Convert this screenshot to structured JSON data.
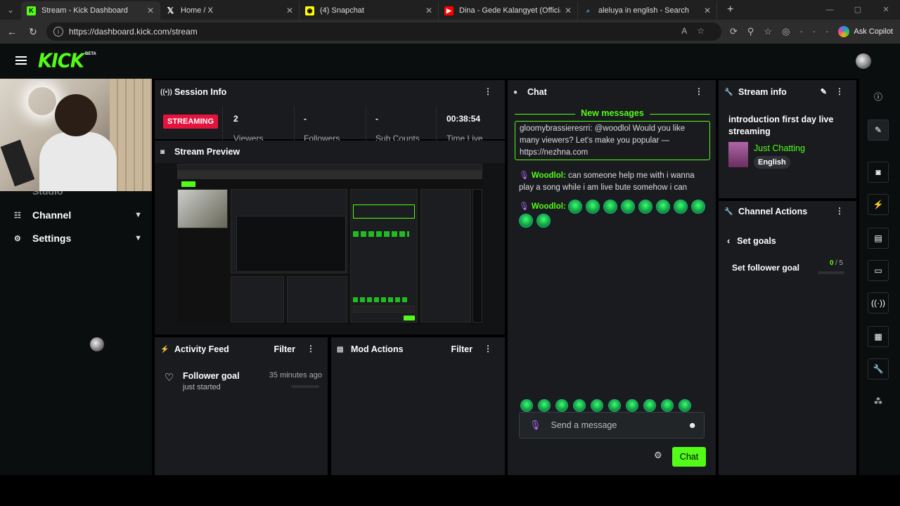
{
  "browser": {
    "tabs": [
      {
        "title": "Stream - Kick Dashboard",
        "close": "✕",
        "icon": "kick-favicon"
      },
      {
        "title": "Home / X",
        "close": "✕",
        "icon": "x-favicon"
      },
      {
        "title": "(4) Snapchat",
        "close": "✕",
        "icon": "snapchat-favicon"
      },
      {
        "title": "Dina - Gede Kalangyet (Official Vi",
        "close": "✕",
        "icon": "youtube-favicon"
      },
      {
        "title": "aleluya in english - Search",
        "close": "✕",
        "icon": "search-favicon"
      }
    ],
    "url": "https://dashboard.kick.com/stream",
    "copilot_label": "Ask Copilot"
  },
  "kick": {
    "logo": "KICK",
    "beta": "BETA",
    "accent": "#53fc18"
  },
  "sidebar": {
    "items": [
      {
        "label": "Studio"
      },
      {
        "label": "Channel"
      },
      {
        "label": "Settings"
      }
    ]
  },
  "session_info": {
    "title": "Session Info",
    "status": "STREAMING",
    "stats": [
      {
        "value": "2",
        "label": "Viewers"
      },
      {
        "value": "-",
        "label": "Followers"
      },
      {
        "value": "-",
        "label": "Sub Counts"
      },
      {
        "value": "00:38:54",
        "label": "Time Live"
      }
    ]
  },
  "stream_preview": {
    "title": "Stream Preview"
  },
  "activity_feed": {
    "title": "Activity Feed",
    "filter": "Filter",
    "items": [
      {
        "title": "Follower goal",
        "sub": "just started",
        "time": "35 minutes ago"
      }
    ]
  },
  "mod_actions": {
    "title": "Mod Actions",
    "filter": "Filter"
  },
  "chat": {
    "title": "Chat",
    "new_messages": "New messages",
    "messages": [
      {
        "user": "gloomybrassieresrri:",
        "text": "@woodlol Would you like many viewers? Let's make you popular — https://nezhna.com"
      },
      {
        "user": "Woodlol:",
        "text": "can someone help me with i wanna play a song while i am live bute somehow i can"
      },
      {
        "user": "Woodlol:",
        "text": ""
      }
    ],
    "placeholder": "Send a message",
    "send_label": "Chat"
  },
  "stream_info": {
    "title": "Stream info",
    "stream_title": "introduction first day live streaming",
    "category": "Just Chatting",
    "language": "English"
  },
  "channel_actions": {
    "title": "Channel Actions",
    "back_label": "Set goals",
    "goal_label": "Set follower goal",
    "goal_current": "0",
    "goal_total": "/ 5",
    "goal_progress": 0
  }
}
